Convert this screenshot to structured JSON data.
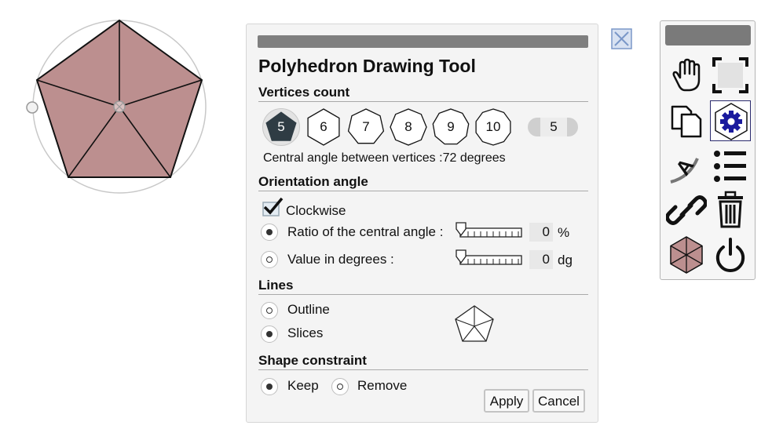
{
  "dialog": {
    "title": "Polyhedron Drawing Tool",
    "vertices": {
      "heading": "Vertices count",
      "options": [
        "5",
        "6",
        "7",
        "8",
        "9",
        "10"
      ],
      "selected": "5",
      "counter_value": "5",
      "central_angle_text": "Central angle between vertices :72 degrees"
    },
    "orientation": {
      "heading": "Orientation angle",
      "clockwise_label": "Clockwise",
      "clockwise_checked": true,
      "ratio_label": "Ratio of the central angle :",
      "ratio_value": "0",
      "ratio_unit": "%",
      "degrees_label": "Value in degrees :",
      "degrees_value": "0",
      "degrees_unit": "dg",
      "selected": "ratio"
    },
    "lines": {
      "heading": "Lines",
      "outline_label": "Outline",
      "slices_label": "Slices",
      "selected": "slices"
    },
    "shape_constraint": {
      "heading": "Shape constraint",
      "keep_label": "Keep",
      "remove_label": "Remove",
      "selected": "keep"
    },
    "apply_label": "Apply",
    "cancel_label": "Cancel"
  },
  "toolbar": {
    "tools": [
      {
        "icon": "hand-icon"
      },
      {
        "icon": "fullscreen-icon"
      },
      {
        "icon": "duplicate-icon"
      },
      {
        "icon": "gear-icon",
        "active": true
      },
      {
        "icon": "text-arc-icon"
      },
      {
        "icon": "list-icon"
      },
      {
        "icon": "link-icon"
      },
      {
        "icon": "trash-icon"
      },
      {
        "icon": "polyhedron-icon"
      },
      {
        "icon": "power-icon"
      }
    ]
  },
  "colors": {
    "shape_fill": "#bc8f8f",
    "selected_vertex": "#2f3c44",
    "accent": "#2b2b8e"
  }
}
